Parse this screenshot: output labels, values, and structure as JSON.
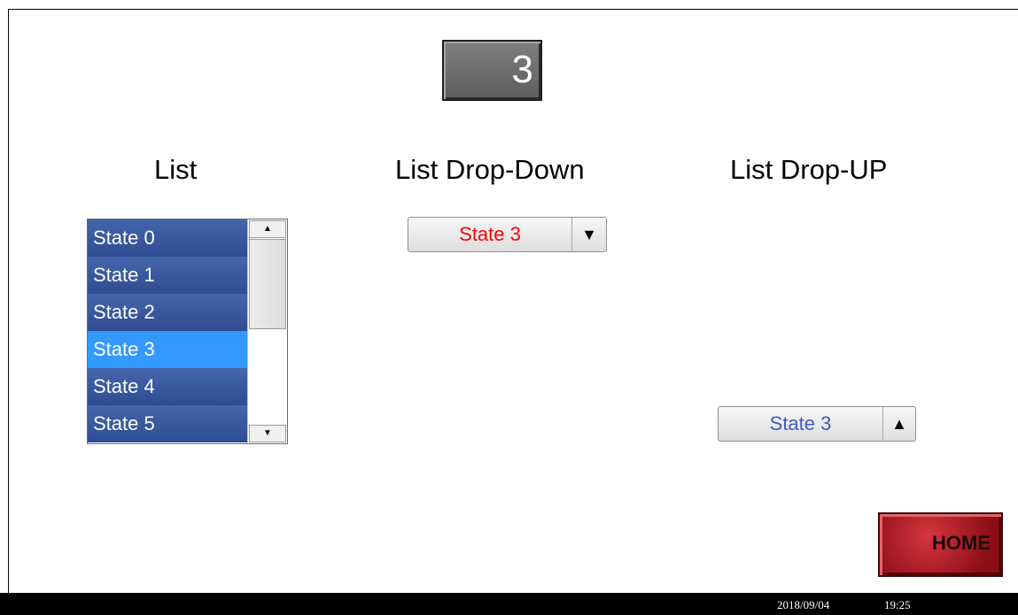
{
  "display": {
    "value": "3"
  },
  "sections": {
    "list_title": "List",
    "dropdown_title": "List Drop-Down",
    "dropup_title": "List Drop-UP"
  },
  "list": {
    "items": [
      "State 0",
      "State 1",
      "State 2",
      "State 3",
      "State 4",
      "State 5"
    ],
    "selected_index": 3,
    "scroll_up": "▲",
    "scroll_down": "▼"
  },
  "dropdown": {
    "value": "State 3",
    "arrow": "▼",
    "text_color": "#ff0000"
  },
  "dropup": {
    "value": "State 3",
    "arrow": "▲",
    "text_color": "#3a5cc4"
  },
  "home_button": {
    "label": "HOME"
  },
  "status_bar": {
    "date": "2018/09/04",
    "time": "19:25"
  },
  "colors": {
    "list_bg": "#2e4c92",
    "list_selected": "#3399ff",
    "home_red": "#b3141e",
    "status_bar": "#000000"
  }
}
